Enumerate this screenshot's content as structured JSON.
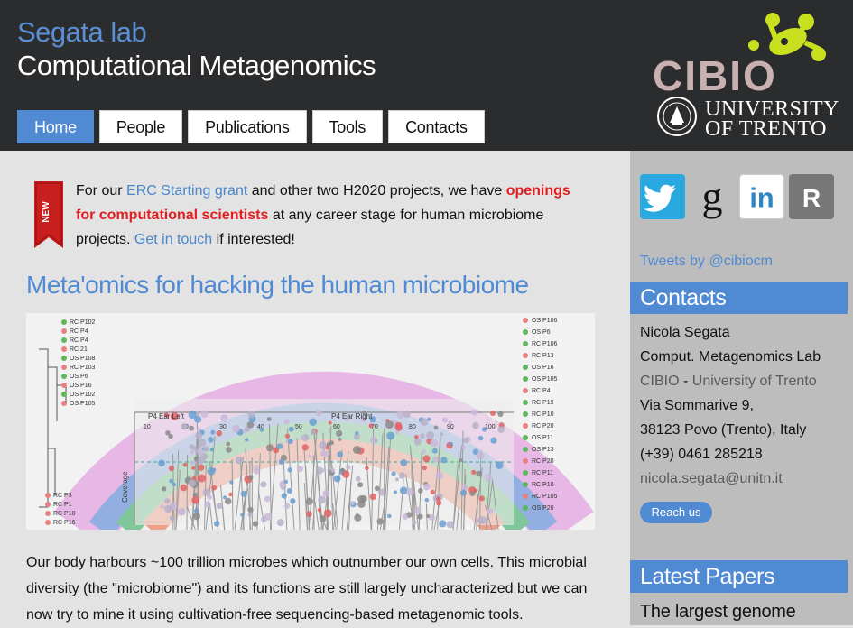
{
  "header": {
    "lab_name": "Segata lab",
    "lab_subtitle": "Computational Metagenomics",
    "cibio_logo_text": "CIBIO",
    "university_line1": "UNIVERSITY",
    "university_line2": "OF TRENTO"
  },
  "nav": {
    "items": [
      {
        "label": "Home",
        "active": true
      },
      {
        "label": "People"
      },
      {
        "label": "Publications"
      },
      {
        "label": "Tools"
      },
      {
        "label": "Contacts"
      }
    ]
  },
  "announcement": {
    "ribbon_text": "NEW",
    "p1": "For our ",
    "link1": "ERC Starting grant",
    "p2": " and other two H2020 projects, we have ",
    "highlight": "openings for computational scientists",
    "p3": " at any career stage for human microbiome projects. ",
    "link2": "Get in touch",
    "p4": " if interested!"
  },
  "main": {
    "heading": "Meta'omics for hacking the human microbiome",
    "figure_labels": {
      "left_samples": [
        "RC P102",
        "RC P4",
        "RC P4",
        "RC 21",
        "OS P108",
        "RC P103",
        "OS P6",
        "OS P16",
        "OS P102",
        "OS P105"
      ],
      "right_samples": [
        "OS P106",
        "OS P6",
        "RC P106",
        "RC P13",
        "OS P16",
        "OS P105",
        "RC P4",
        "RC P19",
        "RC P10",
        "RC P20",
        "OS P11",
        "OS P13",
        "RC P20",
        "RC P11",
        "RC P10",
        "RC P105",
        "OS P20"
      ],
      "bottom_left": [
        "RC P3",
        "RC P1",
        "RC P10",
        "RC P16"
      ],
      "arc_label_left": "P4 Ear Left",
      "arc_label_right": "P4 Ear Right",
      "axis_ticks": [
        "10",
        "20",
        "30",
        "40",
        "50",
        "60",
        "70",
        "80",
        "90",
        "100"
      ],
      "axis_title": "Coverage"
    },
    "body": "Our body harbours ~100 trillion microbes which outnumber our own cells. This microbial diversity (the \"microbiome\") and its functions are still largely uncharacterized but we can now try to mine it using cultivation-free sequencing-based metagenomic tools."
  },
  "sidebar": {
    "social": [
      {
        "name": "twitter-icon",
        "glyph": "t",
        "color": "#2aa9e0"
      },
      {
        "name": "google-scholar-icon",
        "glyph": "g"
      },
      {
        "name": "linkedin-icon",
        "glyph": "in"
      },
      {
        "name": "researchgate-icon",
        "glyph": "RG",
        "color": "#777777"
      }
    ],
    "tweets_label": "Tweets by @cibiocm",
    "contacts_heading": "Contacts",
    "contact": {
      "name": "Nicola Segata",
      "lab": "Comput. Metagenomics Lab",
      "cibio": "CIBIO",
      "dash": " - ",
      "univ": "University of Trento",
      "street": "Via Sommarive 9,",
      "city": "38123 Povo (Trento), Italy",
      "phone": "(+39) 0461 285218",
      "email": "nicola.segata@unitn.it"
    },
    "reach_button": "Reach us",
    "latest_heading": "Latest Papers",
    "latest_first": "The largest genome"
  },
  "colors": {
    "accent": "#4f8ad3",
    "header_bg": "#2b2c2e",
    "cibio_yellow": "#c8e020",
    "alert_red": "#e02020"
  }
}
